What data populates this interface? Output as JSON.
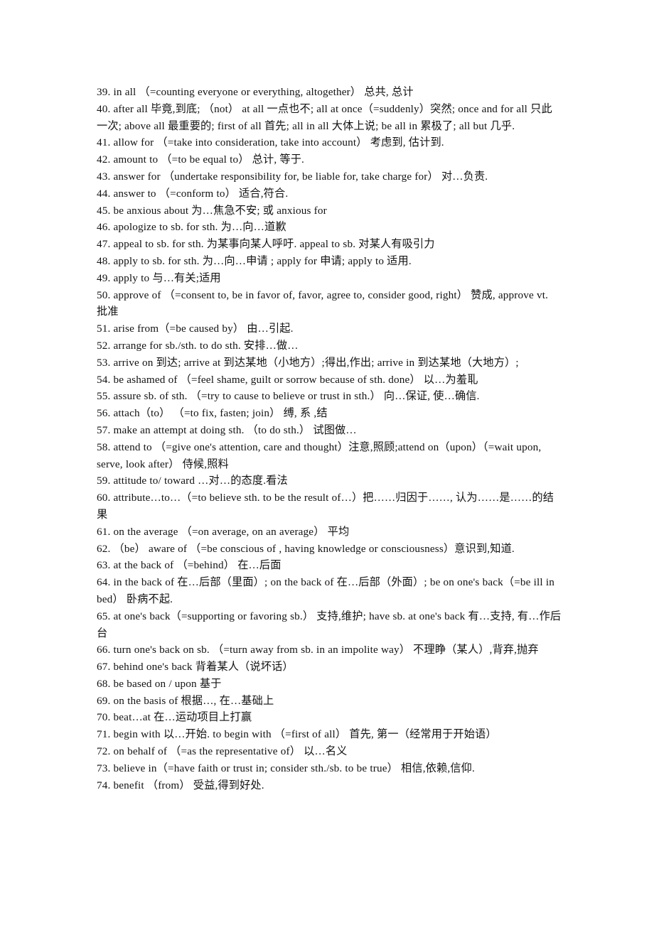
{
  "document": {
    "type": "scanned-phrase-list",
    "language_pair": "English-Chinese",
    "number_range": "39-74",
    "background_color": "#ffffff",
    "text_color": "#121212"
  },
  "entries": [
    {
      "number": "39.",
      "text": "39. in all （=counting everyone or everything, altogether）  总共, 总计"
    },
    {
      "number": "40.",
      "text": "40. after all  毕竟,到底; （not）  at all  一点也不; all at once（=suddenly）突然; once and for all 只此一次; above all  最重要的; first of all  首先; all in all  大体上说; be all in  累极了; all but  几乎."
    },
    {
      "number": "41.",
      "text": "41. allow for （=take into consideration, take into account）  考虑到, 估计到."
    },
    {
      "number": "42.",
      "text": "42. amount to （=to be equal to）  总计, 等于."
    },
    {
      "number": "43.",
      "text": "43. answer for （undertake responsibility for, be liable for, take charge for）  对…负责."
    },
    {
      "number": "44.",
      "text": "44. answer to （=conform to）  适合,符合."
    },
    {
      "number": "45.",
      "text": "45. be anxious about  为…焦急不安; 或 anxious for"
    },
    {
      "number": "46.",
      "text": "46. apologize to sb. for sth.  为…向…道歉"
    },
    {
      "number": "47.",
      "text": "47. appeal to sb. for sth.  为某事向某人呼吁. appeal to sb.  对某人有吸引力"
    },
    {
      "number": "48.",
      "text": "48. apply to sb. for sth.  为…向…申请 ; apply for 申请; apply to  适用."
    },
    {
      "number": "49.",
      "text": "49. apply to  与…有关;适用"
    },
    {
      "number": "50.",
      "text": "50. approve of （=consent to, be in favor of, favor, agree to, consider good, right）  赞成, approve vt. 批准"
    },
    {
      "number": "51.",
      "text": "51. arise from（=be caused by）  由…引起."
    },
    {
      "number": "52.",
      "text": "52. arrange for sb./sth. to do sth.  安排…做…"
    },
    {
      "number": "53.",
      "text": "53. arrive on  到达; arrive at  到达某地（小地方）;得出,作出; arrive in  到达某地（大地方）;"
    },
    {
      "number": "54.",
      "text": "54. be ashamed of （=feel shame, guilt or sorrow because of sth. done）  以…为羞耴"
    },
    {
      "number": "55.",
      "text": "55. assure sb. of sth. （=try to cause to believe or trust in sth.）  向…保证, 使…确信."
    },
    {
      "number": "56.",
      "text": "56. attach（to） （=to fix, fasten; join）  缚, 系 ,结"
    },
    {
      "number": "57.",
      "text": "57. make an attempt at doing sth. （to do sth.）  试图做…"
    },
    {
      "number": "58.",
      "text": "58. attend to （=give one's attention, care and thought）注意,照顾;attend on（upon）（=wait upon, serve, look after）  侍候,照料"
    },
    {
      "number": "59.",
      "text": "59. attitude to/ toward …对…的态度.看法"
    },
    {
      "number": "60.",
      "text": "60. attribute…to…（=to believe sth. to be the result of…）把……归因于……, 认为……是……的结果"
    },
    {
      "number": "61.",
      "text": "61. on the average （=on average, on an average）  平均"
    },
    {
      "number": "62.",
      "text": "62. （be）  aware of （=be conscious of , having knowledge or consciousness）意识到,知道."
    },
    {
      "number": "63.",
      "text": "63. at the back of （=behind）  在…后面"
    },
    {
      "number": "64.",
      "text": "64. in the back of 在…后部（里面）; on the back of 在…后部（外面）; be on one's back（=be ill in bed）  卧病不起."
    },
    {
      "number": "65.",
      "text": "65. at one's back（=supporting or favoring sb.）  支持,维护; have sb. at one's back  有…支持, 有…作后台"
    },
    {
      "number": "66.",
      "text": "66. turn one's back on sb. （=turn away from sb. in an impolite way）  不理睁（某人）,背弃,抛弃"
    },
    {
      "number": "67.",
      "text": "67. behind one's back  背着某人（说坏话）"
    },
    {
      "number": "68.",
      "text": "68. be based on / upon  基于"
    },
    {
      "number": "69.",
      "text": "69. on the basis of  根据…, 在…基础上"
    },
    {
      "number": "70.",
      "text": "70. beat…at  在…运动项目上打赢"
    },
    {
      "number": "71.",
      "text": "71. begin with  以…开始. to begin with （=first of all）  首先, 第一（经常用于开始语）"
    },
    {
      "number": "72.",
      "text": "72. on behalf of （=as the representative of）  以…名义"
    },
    {
      "number": "73.",
      "text": "73. believe in（=have faith or trust in; consider sth./sb. to be true）  相信,依赖,信仰."
    },
    {
      "number": "74.",
      "text": "74. benefit （from）  受益,得到好处."
    }
  ]
}
